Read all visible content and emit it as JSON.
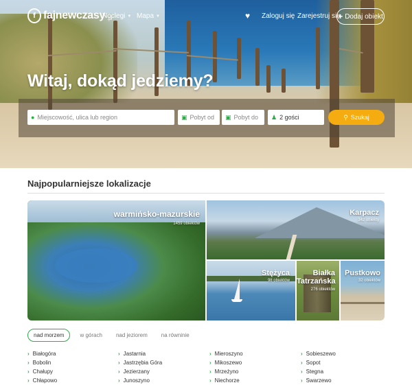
{
  "header": {
    "logo_text": "fajnewczasy",
    "logo_tld": ".pl",
    "nav": [
      {
        "label": "Noclegi",
        "has_dropdown": true
      },
      {
        "label": "Mapa",
        "has_dropdown": true
      }
    ],
    "login_label": "Zaloguj się",
    "register_label": "Zarejestruj się",
    "add_listing_label": "Dodaj obiekt"
  },
  "hero": {
    "headline": "Witaj, dokąd jedziemy?"
  },
  "search": {
    "location_placeholder": "Miejscowość, ulica lub region",
    "date_from_placeholder": "Pobyt od",
    "date_to_placeholder": "Pobyt do",
    "guests_value": "2 gości",
    "submit_label": "Szukaj",
    "accent_color": "#2eaa4a",
    "button_color": "#f5ac10"
  },
  "popular": {
    "title": "Najpopularniejsze lokalizacje",
    "tiles": [
      {
        "name": "warmińsko-mazurskie",
        "count": "1459 obiektów"
      },
      {
        "name": "Karpacz",
        "count": "342 obiekty"
      },
      {
        "name": "Stężyca",
        "count": "98 obiektów"
      },
      {
        "name": "Białka Tatrzańska",
        "count": "276 obiektów"
      },
      {
        "name": "Pustkowo",
        "count": "32 obiektów"
      }
    ],
    "tabs": [
      {
        "label": "nad morzem",
        "active": true
      },
      {
        "label": "w górach",
        "active": false
      },
      {
        "label": "nad jeziorem",
        "active": false
      },
      {
        "label": "na równinie",
        "active": false
      }
    ],
    "columns": [
      [
        "Białogóra",
        "Bobolin",
        "Chałupy",
        "Chłapowo"
      ],
      [
        "Jastarnia",
        "Jastrzębia Góra",
        "Jezierzany",
        "Junoszyno"
      ],
      [
        "Mieroszyno",
        "Mikoszewo",
        "Mrzeżyno",
        "Niechorze"
      ],
      [
        "Sobieszewo",
        "Sopot",
        "Stegna",
        "Swarzewo"
      ]
    ]
  }
}
